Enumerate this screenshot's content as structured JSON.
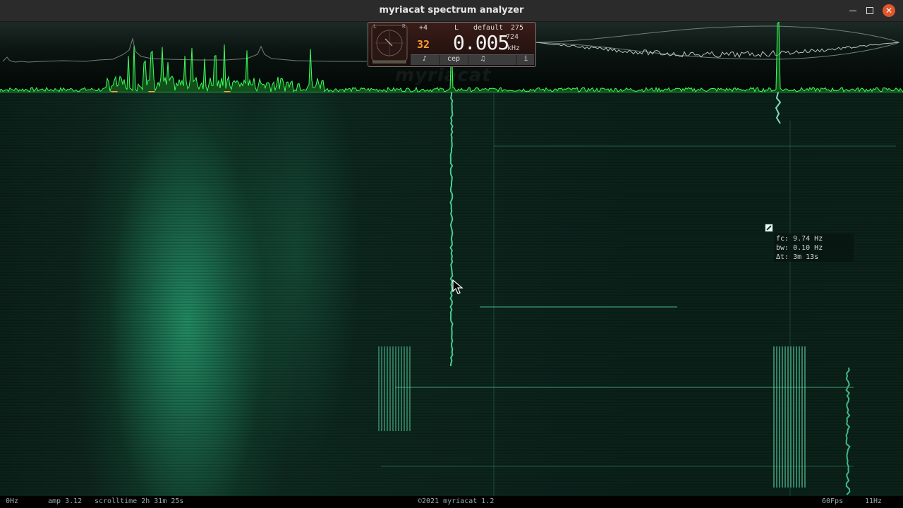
{
  "window": {
    "title": "myriacat spectrum analyzer"
  },
  "panel": {
    "scope_l": "L",
    "scope_r": "R",
    "octave": "+4",
    "channel": "L",
    "preset": "default",
    "preset_number": "275",
    "small_readout": "32",
    "frequency_main": "0.005",
    "frequency_sub": "724",
    "frequency_unit": "kHz",
    "toolbar": {
      "cepstrum_label": "cep",
      "info_label": "i"
    }
  },
  "watermark": "myriacat",
  "measurement": {
    "fc": "fc: 9.74 Hz",
    "bw": "bw: 0.10 Hz",
    "dt": "Δt: 3m 13s"
  },
  "status": {
    "freq_low": "0Hz",
    "amp": "amp 3.12",
    "scrolltime": "scrolltime 2h 31m 25s",
    "copyright": "©2021 myriacat 1.2",
    "fps": "60Fps",
    "freq_high": "11Hz"
  },
  "colors": {
    "accent": "#2bd17a",
    "trace": "#3cff5a",
    "peak_marker": "#e8a33a",
    "close_button": "#e0562a"
  },
  "icons": {
    "minimize": "minimize-icon",
    "maximize": "maximize-icon",
    "close": "close-icon",
    "note": "music-note-icon",
    "cursor": "mouse-pointer-icon",
    "marker": "measurement-marker-icon"
  }
}
